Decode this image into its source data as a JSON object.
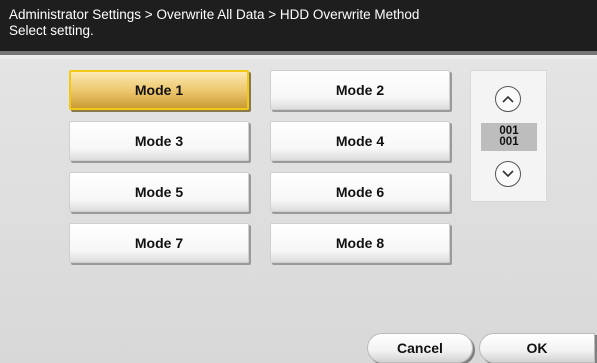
{
  "header": {
    "breadcrumb": "Administrator Settings > Overwrite All Data > HDD Overwrite Method",
    "instruction": "Select setting."
  },
  "modes": [
    {
      "label": "Mode 1",
      "selected": true
    },
    {
      "label": "Mode 2",
      "selected": false
    },
    {
      "label": "Mode 3",
      "selected": false
    },
    {
      "label": "Mode 4",
      "selected": false
    },
    {
      "label": "Mode 5",
      "selected": false
    },
    {
      "label": "Mode 6",
      "selected": false
    },
    {
      "label": "Mode 7",
      "selected": false
    },
    {
      "label": "Mode 8",
      "selected": false
    }
  ],
  "pager": {
    "current_page": "001",
    "total_pages": "001",
    "up_icon": "chevron-up-circle-icon",
    "down_icon": "chevron-down-circle-icon"
  },
  "footer": {
    "cancel_label": "Cancel",
    "ok_label": "OK"
  },
  "colors": {
    "selected_fill": "#ecc56a",
    "selected_border": "#f2c817",
    "header_bg": "#1e1e1e"
  }
}
